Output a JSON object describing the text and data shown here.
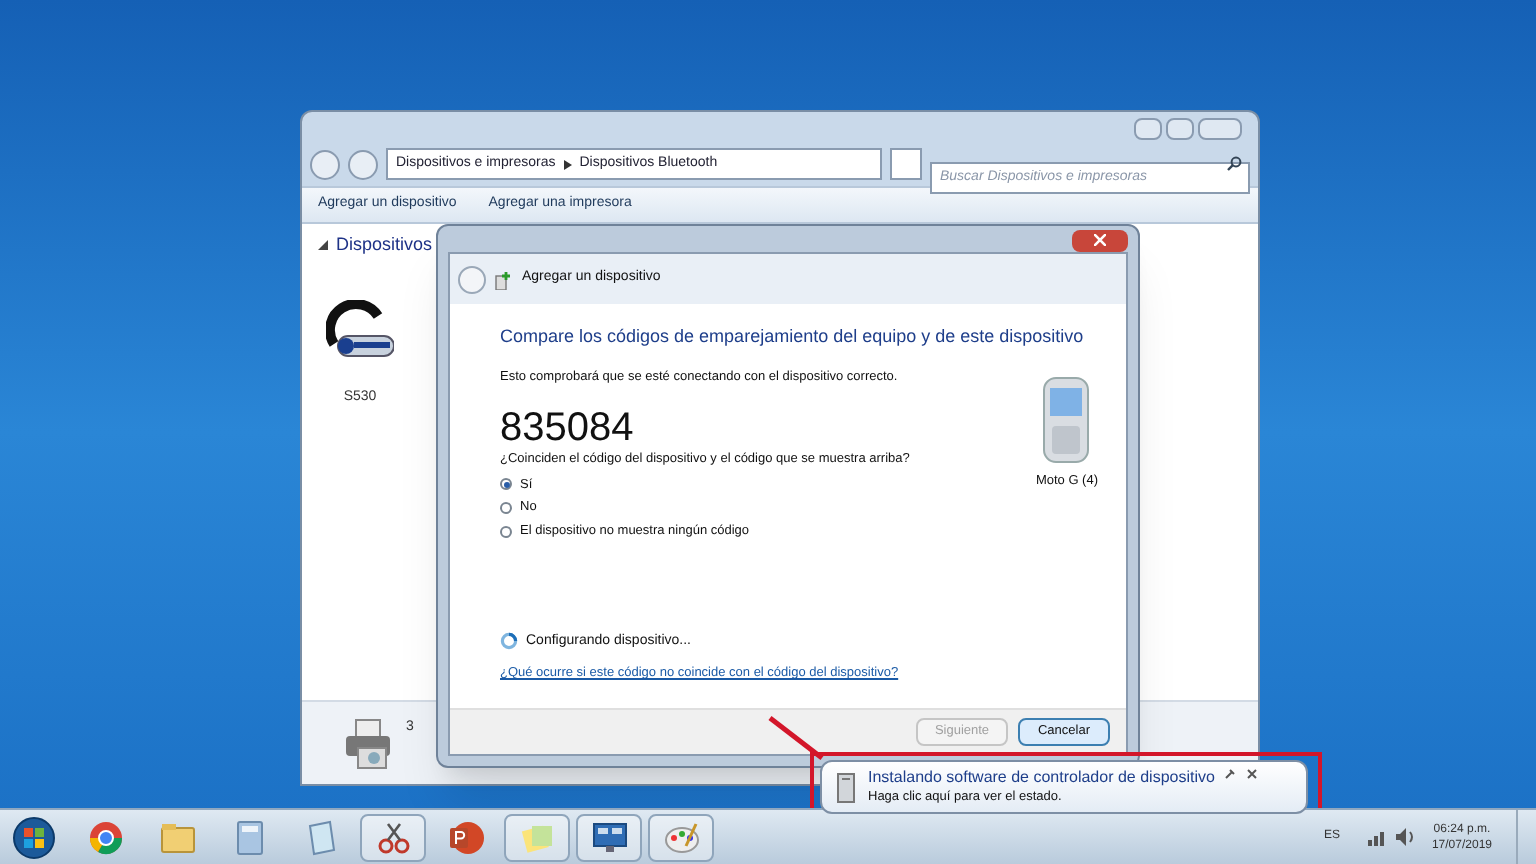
{
  "explorer": {
    "breadcrumb": [
      "Dispositivos e impresoras",
      "Dispositivos Bluetooth"
    ],
    "search": {
      "placeholder": "Buscar Dispositivos e impresoras"
    },
    "toolbar": [
      "Agregar un dispositivo",
      "Agregar una impresora"
    ],
    "section": "Dispositivos",
    "devices": [
      {
        "label": "S530"
      }
    ],
    "printer_label": "3"
  },
  "dialog": {
    "title": "Agregar un dispositivo",
    "heading": "Compare los códigos de emparejamiento del equipo y de este dispositivo",
    "intro": "Esto comprobará que se esté conectando con el dispositivo correcto.",
    "code": "835084",
    "question": "¿Coinciden el código del dispositivo y el código que se muestra arriba?",
    "options": [
      {
        "label": "Sí",
        "selected": true
      },
      {
        "label": "No",
        "selected": false
      },
      {
        "label": "El dispositivo no muestra ningún código",
        "selected": false
      }
    ],
    "device_label": "Moto G (4)",
    "status": "Configurando dispositivo...",
    "help_link": "¿Qué ocurre si este código no coincide con el código del dispositivo?",
    "buttons": [
      {
        "label": "Siguiente",
        "disabled": true
      },
      {
        "label": "Cancelar",
        "disabled": false
      }
    ]
  },
  "notification": {
    "title": "Instalando software de controlador de dispositivo",
    "message": "Haga clic aquí para ver el estado."
  },
  "taskbar": {
    "apps": [
      {
        "kind": "browser",
        "open": false
      },
      {
        "kind": "folder",
        "open": false
      },
      {
        "kind": "calculator",
        "open": false
      },
      {
        "kind": "notepad",
        "open": false
      },
      {
        "kind": "scissors",
        "open": true
      },
      {
        "kind": "slides",
        "open": false
      },
      {
        "kind": "sticky",
        "open": true
      },
      {
        "kind": "monitor",
        "open": true
      },
      {
        "kind": "paint",
        "open": true
      }
    ],
    "language": "ES",
    "time": "06:24 p.m.",
    "date": "17/07/2019"
  }
}
